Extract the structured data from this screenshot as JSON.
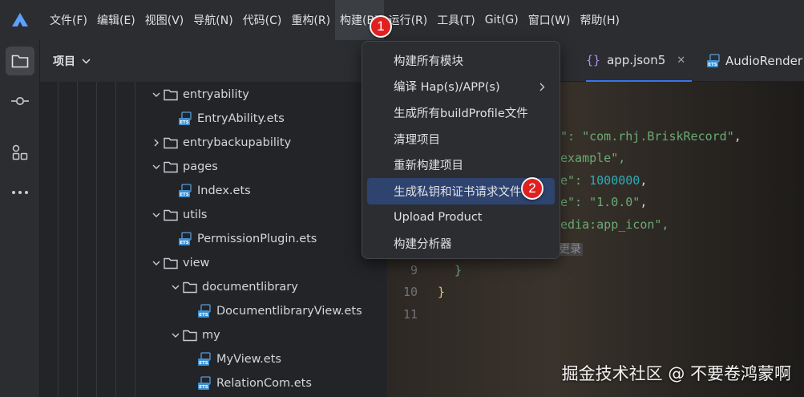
{
  "menubar": {
    "items": [
      {
        "label": "文件(F)"
      },
      {
        "label": "编辑(E)"
      },
      {
        "label": "视图(V)"
      },
      {
        "label": "导航(N)"
      },
      {
        "label": "代码(C)"
      },
      {
        "label": "重构(R)"
      },
      {
        "label": "构建(B)"
      },
      {
        "label": "运行(R)"
      },
      {
        "label": "工具(T)"
      },
      {
        "label": "Git(G)"
      },
      {
        "label": "窗口(W)"
      },
      {
        "label": "帮助(H)"
      }
    ]
  },
  "project_panel": {
    "title": "项目",
    "tree": [
      {
        "label": "entryability",
        "type": "folder",
        "expanded": true
      },
      {
        "label": "EntryAbility.ets",
        "type": "ets"
      },
      {
        "label": "entrybackupability",
        "type": "folder",
        "expanded": false
      },
      {
        "label": "pages",
        "type": "folder",
        "expanded": true
      },
      {
        "label": "Index.ets",
        "type": "ets"
      },
      {
        "label": "utils",
        "type": "folder",
        "expanded": true
      },
      {
        "label": "PermissionPlugin.ets",
        "type": "ets"
      },
      {
        "label": "view",
        "type": "folder",
        "expanded": true
      },
      {
        "label": "documentlibrary",
        "type": "folder",
        "expanded": true
      },
      {
        "label": "DocumentlibraryView.ets",
        "type": "ets"
      },
      {
        "label": "my",
        "type": "folder",
        "expanded": true
      },
      {
        "label": "MyView.ets",
        "type": "ets"
      },
      {
        "label": "RelationCom.ets",
        "type": "ets"
      }
    ]
  },
  "editor": {
    "tabs": [
      {
        "label": "app.json5",
        "active": true
      },
      {
        "label": "AudioRender"
      }
    ],
    "code": {
      "l1_str": "\"com.rhj.BriskRecord\"",
      "l1_tail": ",",
      "l1_head": "\": ",
      "l2": "example\",",
      "l3_head": "e\": ",
      "l3_num": "1000000",
      "l3_tail": ",",
      "l4_head": "e\": ",
      "l4_str": "\"1.0.0\"",
      "l4_tail": ",",
      "l5": "edia:app_icon\",",
      "hint": "更录",
      "brace_inner": "}",
      "brace_outer": "}"
    },
    "line_numbers": [
      "9",
      "10",
      "11"
    ]
  },
  "build_menu": {
    "items": [
      {
        "label": "构建所有模块"
      },
      {
        "label": "编译 Hap(s)/APP(s)",
        "submenu": true
      },
      {
        "label": "生成所有buildProfile文件"
      },
      {
        "label": "清理项目"
      },
      {
        "label": "重新构建项目"
      },
      {
        "label": "生成私钥和证书请求文件",
        "highlighted": true
      },
      {
        "label": "Upload Product"
      },
      {
        "label": "构建分析器"
      }
    ]
  },
  "badges": {
    "b1": "1",
    "b2": "2"
  },
  "watermark": "掘金技术社区 @ 不要卷鸿蒙啊",
  "colors": {
    "accent": "#3574f0",
    "highlight": "#2e436e",
    "badge": "#e02020",
    "string": "#6aab73",
    "number": "#2aacb8"
  }
}
